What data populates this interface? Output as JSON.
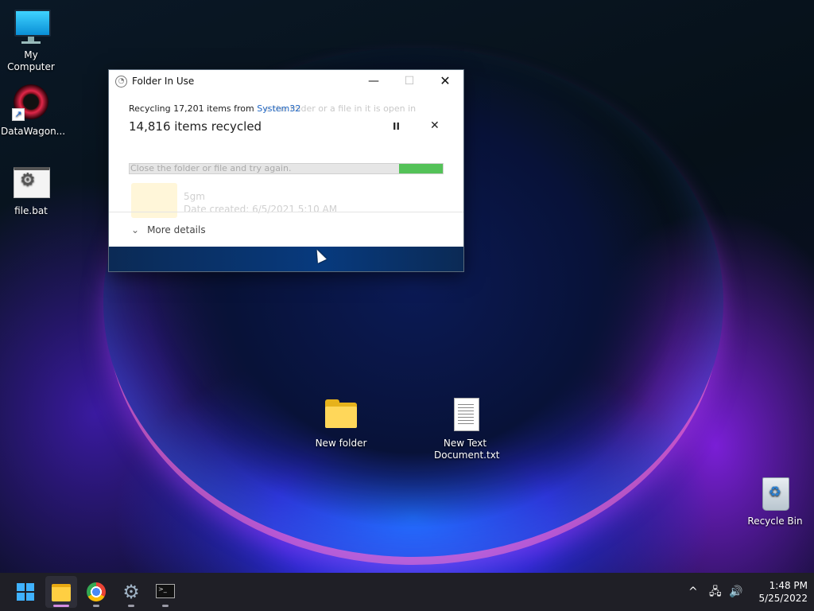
{
  "desktop": {
    "icons": [
      {
        "label": "My Computer",
        "icon": "computer-icon"
      },
      {
        "label": "DataWagon...",
        "icon": "datawagon-shortcut-icon"
      },
      {
        "label": "file.bat",
        "icon": "batch-file-icon"
      },
      {
        "label": "New folder",
        "icon": "folder-icon"
      },
      {
        "label": "New Text Document.txt",
        "icon": "text-document-icon"
      },
      {
        "label": "Recycle Bin",
        "icon": "recycle-bin-icon"
      }
    ]
  },
  "dialog": {
    "title": "Folder In Use",
    "recycling_prefix": "Recycling 17,201 items from ",
    "recycling_source": "System32",
    "ghost_message": "e the folder or a file in it is open in",
    "items_recycled": "14,816 items recycled",
    "progress_fraction": 0.86,
    "ghost_instruction": "Close the folder or file and try again.",
    "ghost_item_name": "5gm",
    "ghost_item_date": "Date created: 6/5/2021 5:10 AM",
    "more_details": "More details",
    "pause_symbol": "II",
    "cancel_symbol": "✕",
    "minimize_symbol": "—",
    "maximize_symbol": "☐",
    "close_symbol": "✕"
  },
  "taskbar": {
    "apps": [
      {
        "name": "start",
        "icon": "windows-logo-icon"
      },
      {
        "name": "file-explorer",
        "icon": "folder-icon",
        "active": true
      },
      {
        "name": "chrome",
        "icon": "chrome-icon"
      },
      {
        "name": "settings",
        "icon": "gear-icon"
      },
      {
        "name": "terminal",
        "icon": "terminal-icon"
      }
    ],
    "tray": {
      "chevron": "^",
      "network": "🖧",
      "volume": "🔊"
    },
    "time": "1:48 PM",
    "date": "5/25/2022"
  }
}
